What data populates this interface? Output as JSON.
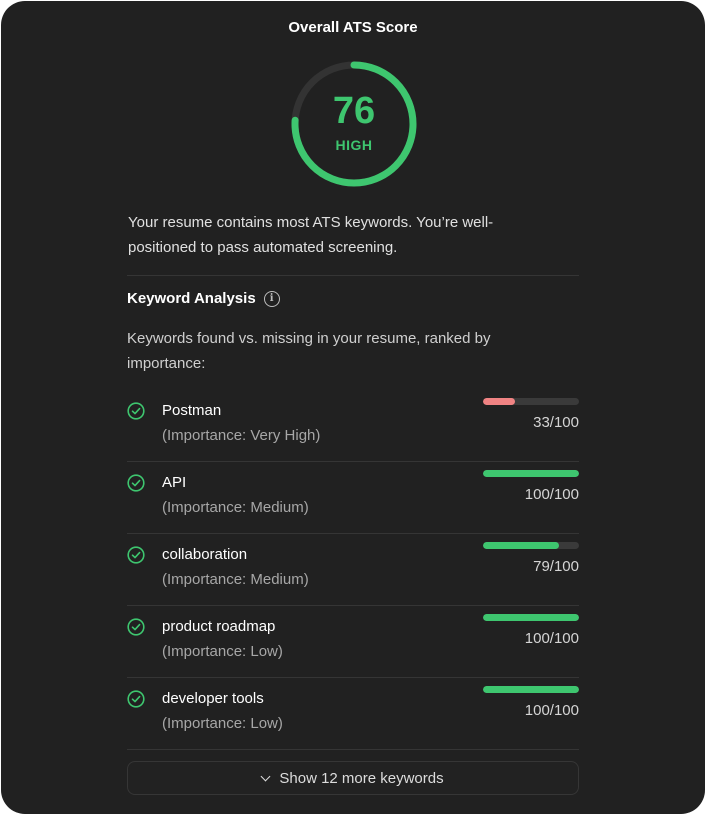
{
  "card": {
    "title": "Overall ATS Score",
    "score": {
      "value": "76",
      "fraction": 0.76,
      "label": "HIGH",
      "color": "#3ec66f"
    },
    "summary": "Your resume contains most ATS keywords. You’re well-positioned to pass automated screening."
  },
  "keyword_analysis": {
    "title": "Keyword Analysis",
    "info_icon": "info-icon",
    "description": "Keywords found vs. missing in your resume, ranked by importance:",
    "keywords": [
      {
        "name": "Postman",
        "importance": "(Importance: Very High)",
        "score_text": "33/100",
        "score": 33,
        "status_icon": "check-circle-icon",
        "bar_color": "#f08383"
      },
      {
        "name": "API",
        "importance": "(Importance: Medium)",
        "score_text": "100/100",
        "score": 100,
        "status_icon": "check-circle-icon",
        "bar_color": "#3ec66f"
      },
      {
        "name": "collaboration",
        "importance": "(Importance: Medium)",
        "score_text": "79/100",
        "score": 79,
        "status_icon": "check-circle-icon",
        "bar_color": "#3ec66f"
      },
      {
        "name": "product roadmap",
        "importance": "(Importance: Low)",
        "score_text": "100/100",
        "score": 100,
        "status_icon": "check-circle-icon",
        "bar_color": "#3ec66f"
      },
      {
        "name": "developer tools",
        "importance": "(Importance: Low)",
        "score_text": "100/100",
        "score": 100,
        "status_icon": "check-circle-icon",
        "bar_color": "#3ec66f"
      }
    ],
    "show_more_label": "Show 12 more keywords",
    "show_more_icon": "chevron-down-icon"
  }
}
